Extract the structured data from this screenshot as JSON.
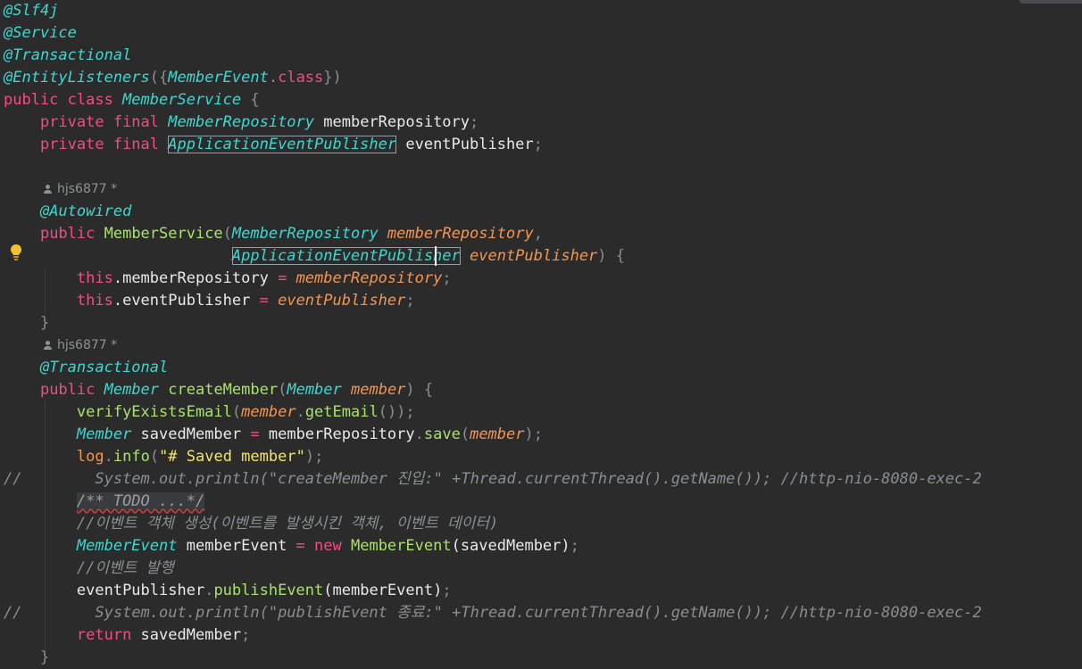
{
  "blame": {
    "user_icon": "user-icon",
    "author_1": "hjs6877 *",
    "author_2": "hjs6877 *"
  },
  "code": {
    "ann_slf4j": "@Slf4j",
    "ann_service": "@Service",
    "ann_transactional_1": "@Transactional",
    "ann_entity_listeners": "@EntityListeners",
    "ann_entity_open": "({",
    "ann_entity_type": "MemberEvent",
    "ann_entity_dot": ".",
    "ann_entity_class": "class",
    "ann_entity_close": "})",
    "kw_public_class": "public class ",
    "class_name": "MemberService",
    "class_brace": " {",
    "f1_kw": "private final ",
    "f1_type": "MemberRepository",
    "f1_name": " memberRepository",
    "f1_semi": ";",
    "f2_kw": "private final ",
    "f2_type": "ApplicationEventPublisher",
    "f2_name": " eventPublisher",
    "f2_semi": ";",
    "ann_autowired": "@Autowired",
    "ctor_kw": "public ",
    "ctor_name": "MemberService",
    "ctor_open": "(",
    "ctor_p1_type": "MemberRepository",
    "ctor_p1_name": " memberRepository",
    "ctor_comma": ",",
    "ctor_p2_type_a": "ApplicationEventPub",
    "ctor_p2_type_b": "lisher",
    "ctor_p2_name": " eventPublisher",
    "ctor_close": ") {",
    "assign1_this": "this",
    "assign1_field": ".memberRepository ",
    "assign1_eq": "= ",
    "assign1_val": "memberRepository",
    "assign1_semi": ";",
    "assign2_this": "this",
    "assign2_field": ".eventPublisher ",
    "assign2_eq": "= ",
    "assign2_val": "eventPublisher",
    "assign2_semi": ";",
    "ctor_end": "}",
    "ann_transactional_2": "@Transactional",
    "m_kw": "public ",
    "m_ret": "Member",
    "m_name": " createMember",
    "m_open": "(",
    "m_ptype": "Member",
    "m_pname": " member",
    "m_close": ") {",
    "l1_call": "verifyExistsEmail",
    "l1_open": "(",
    "l1_arg": "member",
    "l1_dot": ".",
    "l1_getter": "getEmail",
    "l1_end": "());",
    "l2_type": "Member",
    "l2_var": " savedMember ",
    "l2_eq": "= ",
    "l2_recv": "memberRepository",
    "l2_dot": ".",
    "l2_save": "save",
    "l2_open": "(",
    "l2_arg": "member",
    "l2_end": ");",
    "l3_log": "log",
    "l3_dot": ".",
    "l3_info": "info",
    "l3_open": "(",
    "l3_str": "\"# Saved member\"",
    "l3_end": ");",
    "c1_slash": "//",
    "c1_text": "System.out.println(\"createMember 진입:\" +Thread.currentThread().getName()); //http-nio-8080-exec-2",
    "todo_fold": "/** TODO ...*/",
    "cmt_1": "//이벤트 객체 생성(이벤트를 발생시킨 객체, 이벤트 데이터)",
    "l4_type": "MemberEvent",
    "l4_var": " memberEvent ",
    "l4_eq": "= ",
    "l4_new": "new ",
    "l4_ctor": "MemberEvent",
    "l4_args": "(savedMember)",
    "l4_semi": ";",
    "cmt_2": "//이벤트 발행",
    "l5_recv": "eventPublisher",
    "l5_dot": ".",
    "l5_call": "publishEvent",
    "l5_args": "(memberEvent)",
    "l5_semi": ";",
    "c2_slash": "//",
    "c2_text": "System.out.println(\"publishEvent 종료:\" +Thread.currentThread().getName()); //http-nio-8080-exec-2",
    "ret_kw": "return ",
    "ret_val": "savedMember",
    "ret_semi": ";",
    "method_end": "}"
  },
  "gutter": {
    "bulb_icon": "lightbulb-icon"
  },
  "colors": {
    "background": "#2b2b2b",
    "annotation": "#3dd7d0",
    "keyword": "#f04c86",
    "parameter": "#f29552",
    "method": "#a8e26a",
    "string": "#f4e36a",
    "comment": "#8a8d92"
  }
}
